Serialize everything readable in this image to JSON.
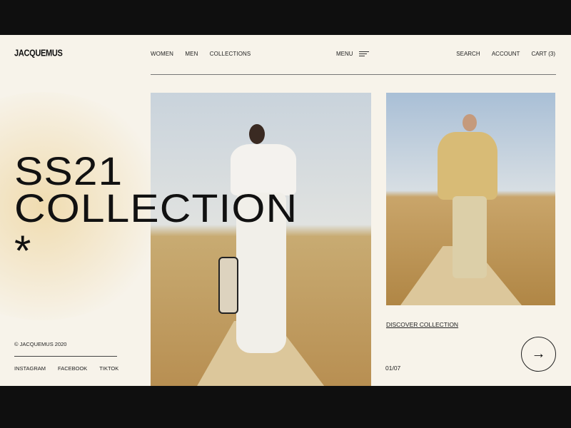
{
  "brand": "JACQUEMUS",
  "nav": {
    "left": [
      "WOMEN",
      "MEN",
      "COLLECTIONS"
    ],
    "menu": "MENU",
    "right": [
      "SEARCH",
      "ACCOUNT",
      "CART (3)"
    ]
  },
  "hero": {
    "line1": "SS21",
    "line2": "COLLECTION",
    "symbol": "*"
  },
  "footer": {
    "copyright": "© JACQUEMUS 2020",
    "social": [
      "INSTAGRAM",
      "FACEBOOK",
      "TIKTOK"
    ]
  },
  "slider": {
    "cta": "DISCOVER COLLECTION",
    "counter": "01/07",
    "next_arrow": "→"
  }
}
